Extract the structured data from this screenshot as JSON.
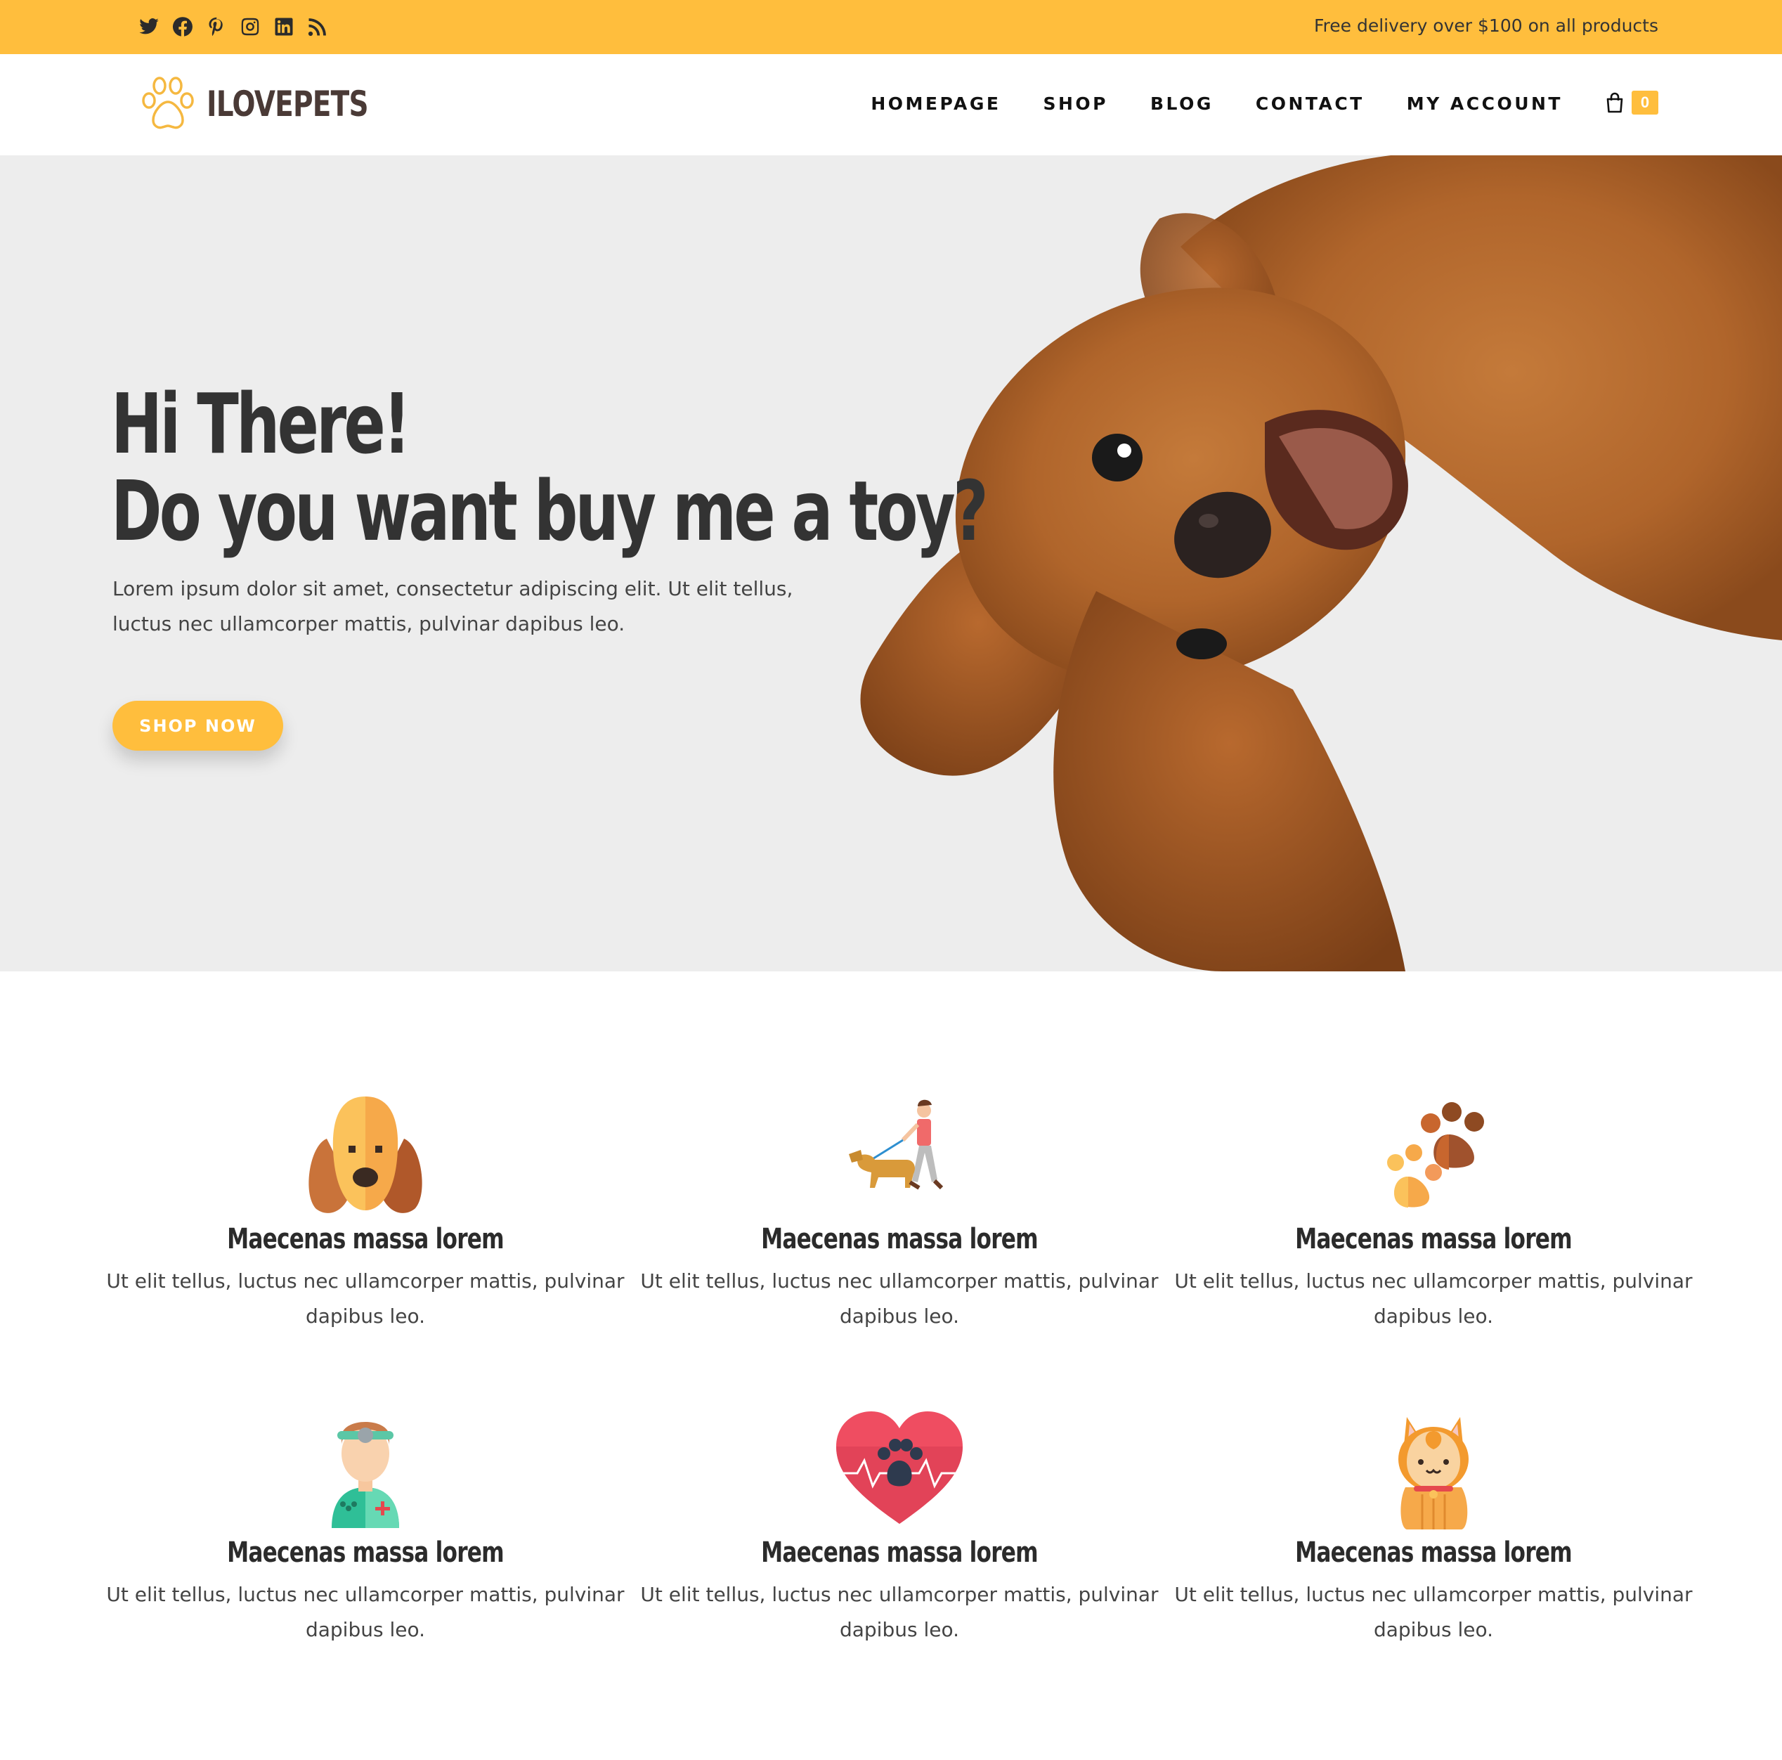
{
  "topbar": {
    "social_icons": [
      "twitter-icon",
      "facebook-icon",
      "pinterest-icon",
      "instagram-icon",
      "linkedin-icon",
      "rss-icon"
    ],
    "delivery_text": "Free delivery over $100 on all products",
    "background": "#FFBE3D"
  },
  "header": {
    "logo_text": "ILOVEPETS",
    "nav": [
      "HOMEPAGE",
      "SHOP",
      "BLOG",
      "CONTACT",
      "MY ACCOUNT"
    ],
    "cart_count": "0"
  },
  "hero": {
    "title_line1": "Hi There!",
    "title_line2": "Do you want buy me a toy?",
    "text": "Lorem ipsum dolor sit amet, consectetur adipiscing elit. Ut elit tellus, luctus nec ullamcorper mattis, pulvinar dapibus leo.",
    "button": "SHOP NOW"
  },
  "features": [
    {
      "icon": "dog-face-icon",
      "title": "Maecenas massa lorem",
      "text": "Ut elit tellus, luctus nec ullamcorper mattis, pulvinar dapibus leo."
    },
    {
      "icon": "dog-walker-icon",
      "title": "Maecenas massa lorem",
      "text": "Ut elit tellus, luctus nec ullamcorper mattis, pulvinar dapibus leo."
    },
    {
      "icon": "paw-prints-icon",
      "title": "Maecenas massa lorem",
      "text": "Ut elit tellus, luctus nec ullamcorper mattis, pulvinar dapibus leo."
    },
    {
      "icon": "veterinarian-icon",
      "title": "Maecenas massa lorem",
      "text": "Ut elit tellus, luctus nec ullamcorper mattis, pulvinar dapibus leo."
    },
    {
      "icon": "heart-paw-icon",
      "title": "Maecenas massa lorem",
      "text": "Ut elit tellus, luctus nec ullamcorper mattis, pulvinar dapibus leo."
    },
    {
      "icon": "cat-icon",
      "title": "Maecenas massa lorem",
      "text": "Ut elit tellus, luctus nec ullamcorper mattis, pulvinar dapibus leo."
    }
  ],
  "colors": {
    "accent": "#FFBE3D",
    "hero_bg": "#EDEDED",
    "heading": "#333333"
  }
}
